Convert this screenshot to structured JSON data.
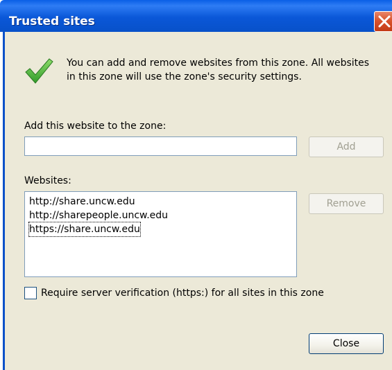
{
  "window": {
    "title": "Trusted sites"
  },
  "intro_text": {
    "line1": "You can add and remove websites from this zone. All websites",
    "line2": "in this zone will use the zone's security settings."
  },
  "add_website": {
    "label": "Add this website to the zone:",
    "value": "",
    "button": "Add"
  },
  "websites": {
    "label": "Websites:",
    "items": [
      "http://share.uncw.edu",
      "http://sharepeople.uncw.edu",
      "https://share.uncw.edu"
    ],
    "remove_button": "Remove"
  },
  "verification": {
    "label": "Require server verification (https:) for all sites in this zone",
    "checked": false
  },
  "close_button": "Close",
  "icons": {
    "status": "checkmark-icon",
    "close": "close-icon"
  }
}
